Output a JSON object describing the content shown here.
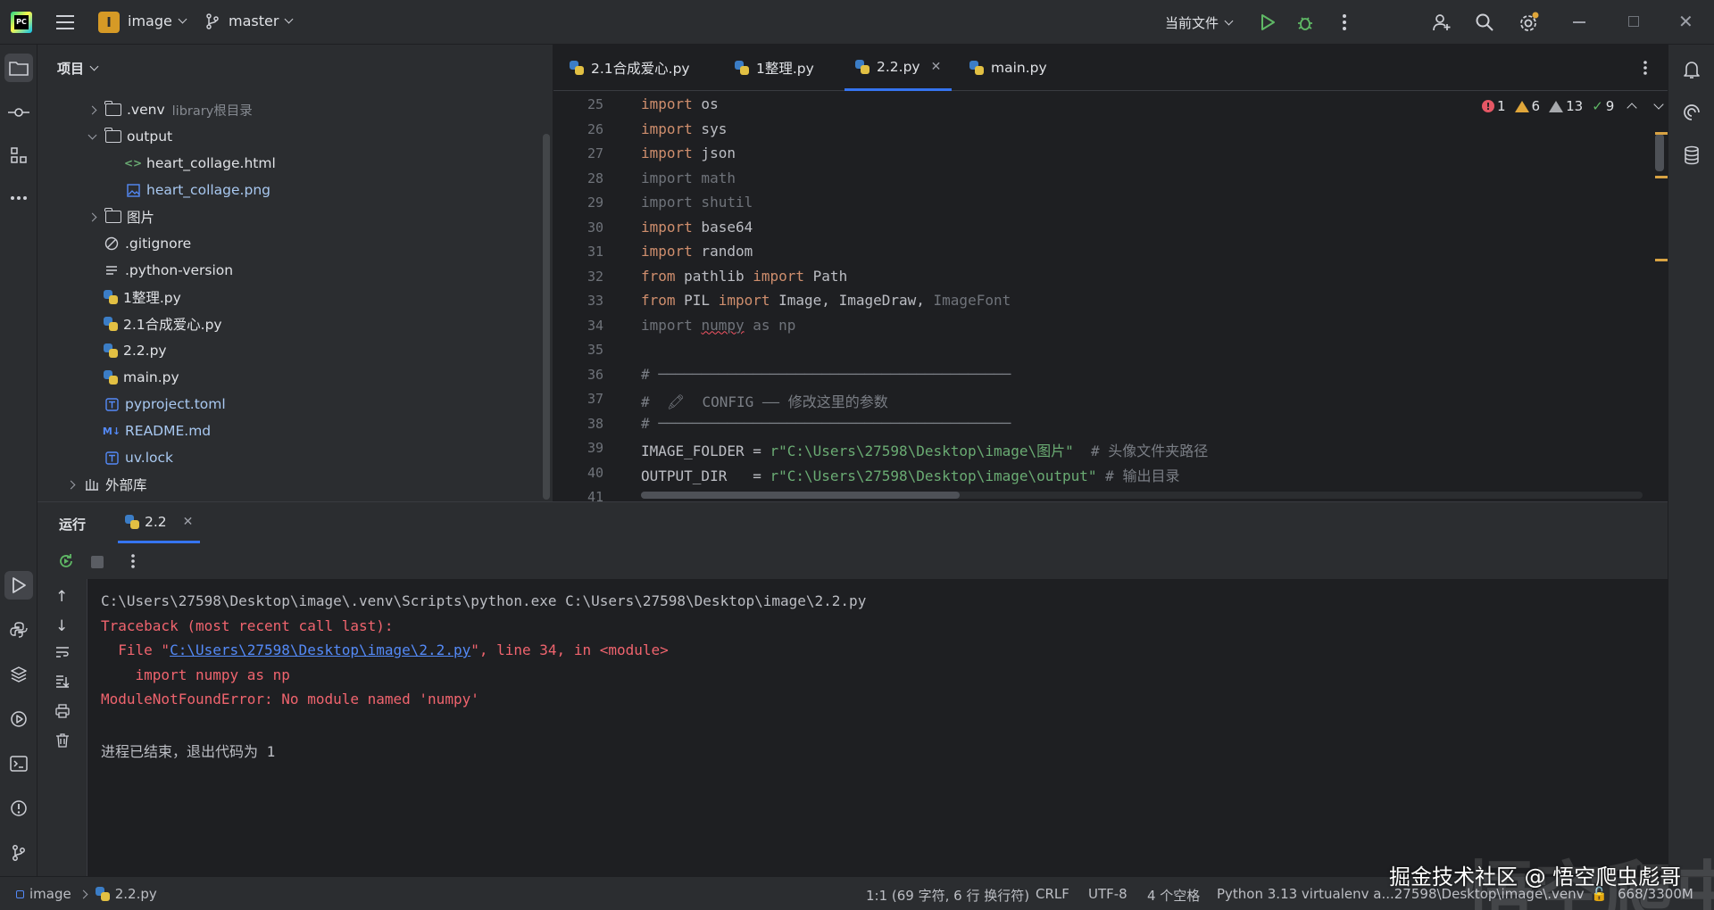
{
  "titlebar": {
    "project_initial": "I",
    "project_name": "image",
    "branch": "master",
    "run_config": "当前文件"
  },
  "project_panel": {
    "title": "项目",
    "items": [
      {
        "label": ".venv",
        "note": "library根目录",
        "type": "folder",
        "expanded": false
      },
      {
        "label": "output",
        "type": "folder",
        "expanded": true
      },
      {
        "label": "heart_collage.html",
        "type": "html"
      },
      {
        "label": "heart_collage.png",
        "type": "image"
      },
      {
        "label": "图片",
        "type": "folder",
        "expanded": false
      },
      {
        "label": ".gitignore",
        "type": "gitignore"
      },
      {
        "label": ".python-version",
        "type": "text"
      },
      {
        "label": "1整理.py",
        "type": "python"
      },
      {
        "label": "2.1合成爱心.py",
        "type": "python"
      },
      {
        "label": "2.2.py",
        "type": "python"
      },
      {
        "label": "main.py",
        "type": "python"
      },
      {
        "label": "pyproject.toml",
        "type": "toml"
      },
      {
        "label": "README.md",
        "type": "markdown"
      },
      {
        "label": "uv.lock",
        "type": "toml"
      },
      {
        "label": "外部库",
        "type": "library",
        "expanded": false
      }
    ]
  },
  "editor_tabs": [
    {
      "label": "2.1合成爱心.py",
      "active": false
    },
    {
      "label": "1整理.py",
      "active": false
    },
    {
      "label": "2.2.py",
      "active": true
    },
    {
      "label": "main.py",
      "active": false
    }
  ],
  "inspections": {
    "errors": "1",
    "warnings": "6",
    "weak_warnings": "13",
    "ok": "9"
  },
  "code_lines": [
    {
      "n": "25",
      "kw": "import",
      "rest": " os"
    },
    {
      "n": "26",
      "kw": "import",
      "rest": " sys"
    },
    {
      "n": "27",
      "kw": "import",
      "rest": " json"
    },
    {
      "n": "28",
      "kw": "import",
      "rest": " math",
      "unused": true
    },
    {
      "n": "29",
      "kw": "import",
      "rest": " shutil",
      "unused": true
    },
    {
      "n": "30",
      "kw": "import",
      "rest": " base64"
    },
    {
      "n": "31",
      "kw": "import",
      "rest": " random"
    },
    {
      "n": "32",
      "kw": "from",
      "mid": " pathlib ",
      "kw2": "import",
      "rest": " Path"
    },
    {
      "n": "33",
      "kw": "from",
      "mid": " PIL ",
      "kw2": "import",
      "rest": " Image, ImageDraw, ",
      "tail_gray": "ImageFont"
    },
    {
      "n": "34",
      "text": "import numpy as np"
    },
    {
      "n": "35",
      "text": ""
    },
    {
      "n": "36",
      "comment": "# ─────────────────────────────────────────"
    },
    {
      "n": "37",
      "comment": "#  🖍  CONFIG —— 修改这里的参数"
    },
    {
      "n": "38",
      "comment": "# ─────────────────────────────────────────"
    },
    {
      "n": "39",
      "var": "IMAGE_FOLDER = ",
      "str": "r\"C:\\Users\\27598\\Desktop\\image\\图片\"",
      "comment": "  # 头像文件夹路径"
    },
    {
      "n": "40",
      "var": "OUTPUT_DIR   = ",
      "str": "r\"C:\\Users\\27598\\Desktop\\image\\output\"",
      "comment": " # 输出目录"
    },
    {
      "n": "41",
      "text": ""
    }
  ],
  "run_panel": {
    "title": "运行",
    "tab": "2.2",
    "console": {
      "cmd": "C:\\Users\\27598\\Desktop\\image\\.venv\\Scripts\\python.exe C:\\Users\\27598\\Desktop\\image\\2.2.py",
      "traceback": "Traceback (most recent call last):",
      "file_prefix": "  File \"",
      "file_link": "C:\\Users\\27598\\Desktop\\image\\2.2.py",
      "file_suffix": "\", line 34, in <module>",
      "code": "    import numpy as np",
      "error": "ModuleNotFoundError: No module named 'numpy'",
      "exit": "进程已结束，退出代码为 1"
    }
  },
  "statusbar": {
    "breadcrumb_project": "image",
    "breadcrumb_file": "2.2.py",
    "position": "1:1 (69 字符, 6 行 换行符)",
    "line_sep": "CRLF",
    "encoding": "UTF-8",
    "indent": "4 个空格",
    "interpreter": "Python 3.13 virtualenv a...27598\\Desktop\\image\\.venv",
    "memory": "668/3300M"
  },
  "watermark": "掘金技术社区 @ 悟空爬虫彪哥",
  "watermark_big": "悟空爬虫"
}
